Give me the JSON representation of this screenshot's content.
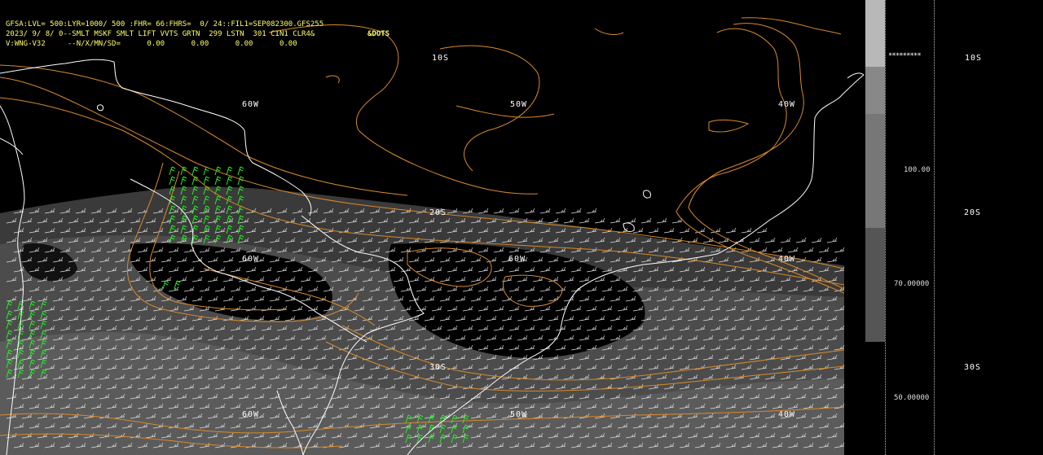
{
  "header": {
    "line1": "GFSA:LVL= 500:LYR=1000/ 500 :FHR= 66:FHRS=  0/ 24::FIL1=SEP082300.GFS255",
    "line2": "2023/ 9/ 8/ 0--SMLT MSKF SMLT LIFT VVTS GRTN  299 LSTN  301 CIN1 CLR4&",
    "line3": "V:WNG-V32     --N/X/MN/SD=      0.00      0.00      0.00      0.00",
    "dots_label": "&DOTS"
  },
  "grid_labels": {
    "lat_10s": "10S",
    "lat_20s": "20S",
    "lat_30s": "30S",
    "lon_60w": "60W",
    "lon_50w": "50W",
    "lon_40w": "40W",
    "stars": "*********"
  },
  "colorbar": {
    "labels": [
      "100.00",
      "70.00000",
      "50.00000"
    ],
    "shades": [
      "#777777",
      "#555555",
      "#333333"
    ],
    "top_shade": "#888888"
  },
  "side_lat_labels": [
    "10S",
    "20S",
    "30S"
  ],
  "colors": {
    "background": "#000000",
    "contour": "#d98a2a",
    "coastline": "#ffffff",
    "wind_barb": "#dddddd",
    "wind_barb_highlight": "#22ee22",
    "header_text": "#ffff66",
    "shade_dark": "#3a3a3a",
    "shade_mid": "#4c4c4c",
    "shade_light": "#5e5e5e"
  }
}
